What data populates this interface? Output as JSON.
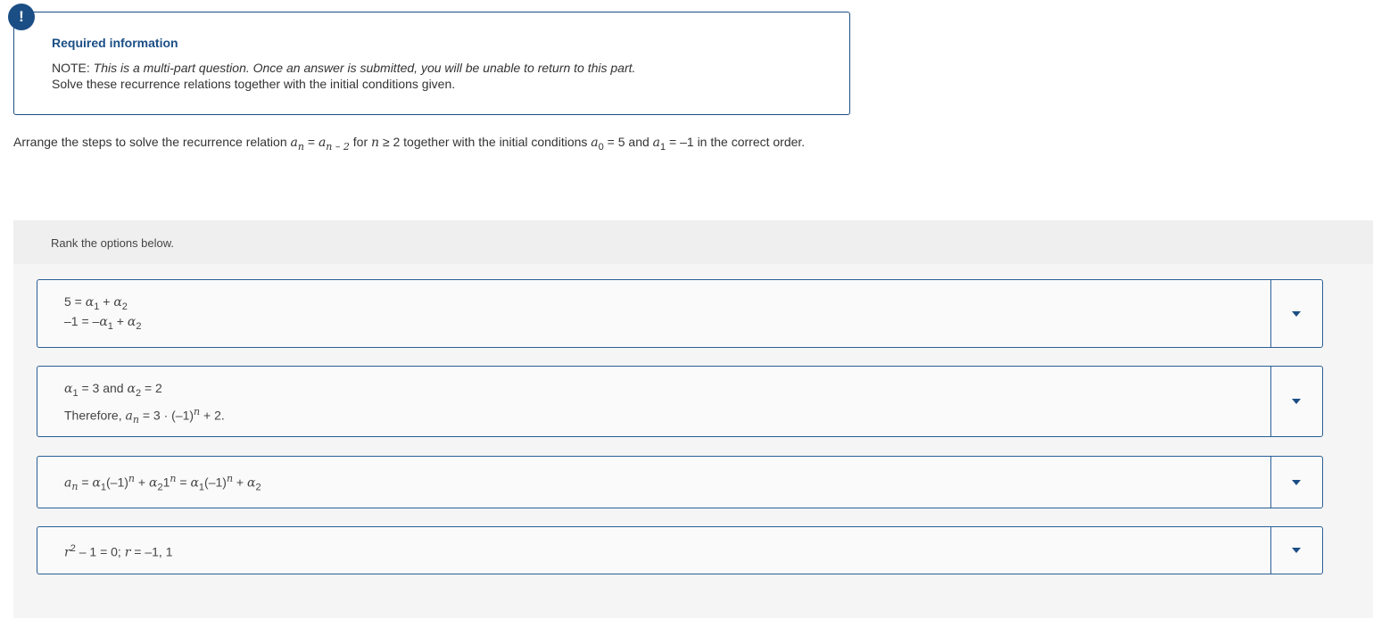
{
  "alert": {
    "badge": "!"
  },
  "info": {
    "title": "Required information",
    "note_prefix": "NOTE: ",
    "note_italic": "This is a multi-part question. Once an answer is submitted, you will be unable to return to this part.",
    "sub": "Solve these recurrence relations together with the initial conditions given."
  },
  "prompt": {
    "p1": "Arrange the steps to solve the recurrence relation ",
    "a": "a",
    "n": "n",
    "eq": " = ",
    "a2": "a",
    "nminus2": "n – 2",
    "p2": " for ",
    "n2": "n",
    "p3": " ≥ 2 together with the initial conditions ",
    "a3": "a",
    "sub0": "0",
    "p4": " = 5 and ",
    "a4": "a",
    "sub1": "1",
    "p5": " = –1 in the correct order."
  },
  "rank": {
    "header": "Rank the options below.",
    "cards": [
      {
        "line1": "5 = α₁ + α₂",
        "line2": "–1 = –α₁ + α₂"
      },
      {
        "line1": "α₁ = 3 and α₂ = 2",
        "line2": "Therefore, aₙ = 3 · (–1)ⁿ + 2."
      },
      {
        "line1": "aₙ = α₁(–1)ⁿ + α₂1ⁿ = α₁(–1)ⁿ + α₂"
      },
      {
        "line1": "r² – 1 = 0; r = –1, 1"
      }
    ]
  }
}
